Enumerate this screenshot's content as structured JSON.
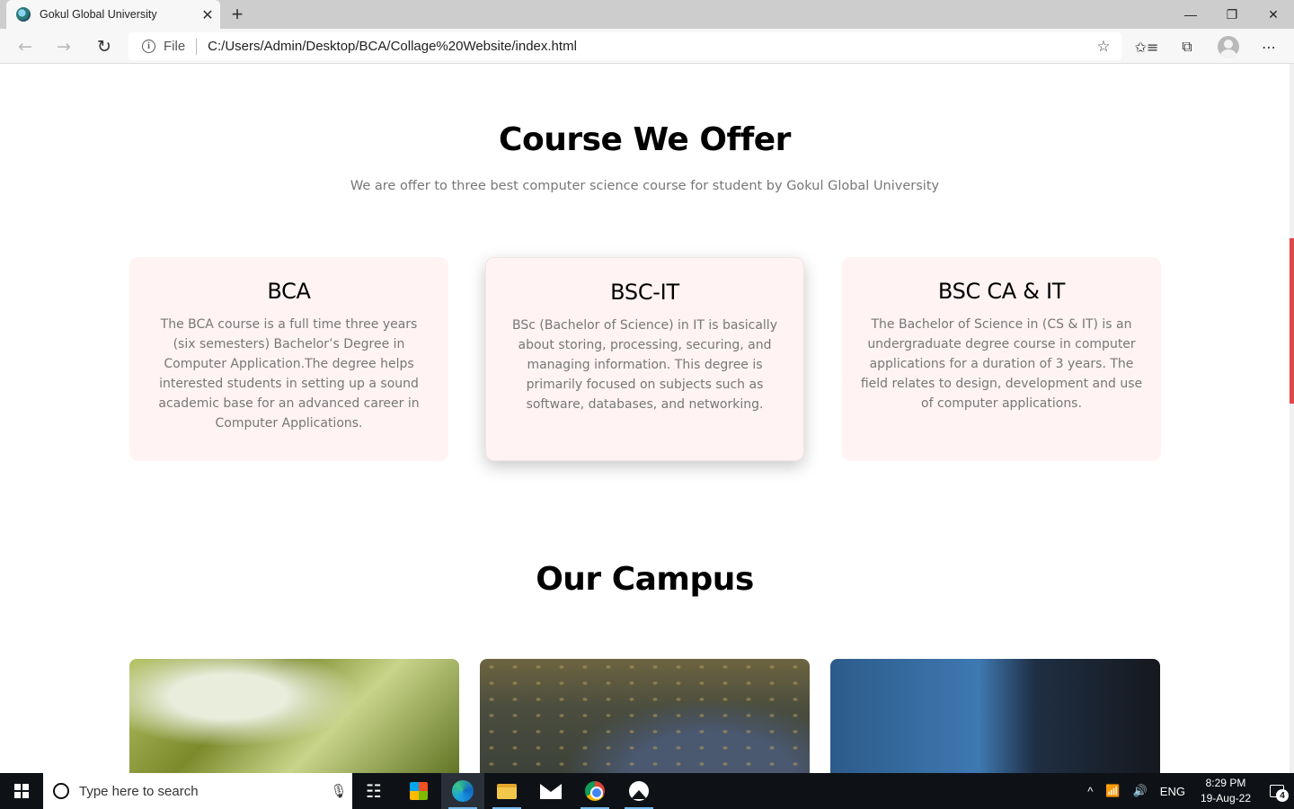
{
  "browser": {
    "tab_title": "Gokul Global University",
    "new_tab_symbol": "+",
    "url_scheme": "File",
    "url": "C:/Users/Admin/Desktop/BCA/Collage%20Website/index.html",
    "window_controls": {
      "minimize": "—",
      "restore": "❐",
      "close": "✕"
    }
  },
  "courses": {
    "title": "Course We Offer",
    "subtitle": "We are offer to three best computer science course for student by Gokul Global University",
    "cards": [
      {
        "title": "BCA",
        "text": "The BCA course is a full time three years (six semesters) Bachelor’s Degree in Computer Application.The degree helps interested students in setting up a sound academic base for an advanced career in Computer Applications."
      },
      {
        "title": "BSC-IT",
        "text": "BSc (Bachelor of Science) in IT is basically about storing, processing, securing, and managing information. This degree is primarily focused on subjects such as software, databases, and networking."
      },
      {
        "title": "BSC CA & IT",
        "text": "The Bachelor of Science in (CS & IT) is an undergraduate degree course in computer applications for a duration of 3 years. The field relates to design, development and use of computer applications."
      }
    ]
  },
  "campus": {
    "title": "Our Campus"
  },
  "taskbar": {
    "search_placeholder": "Type here to search",
    "language": "ENG",
    "time": "8:29 PM",
    "date": "19-Aug-22",
    "notification_count": "4"
  },
  "colors": {
    "card_bg": "#fff3f3",
    "scroll_thumb": "#e04848",
    "taskbar_bg": "#0e1217"
  }
}
